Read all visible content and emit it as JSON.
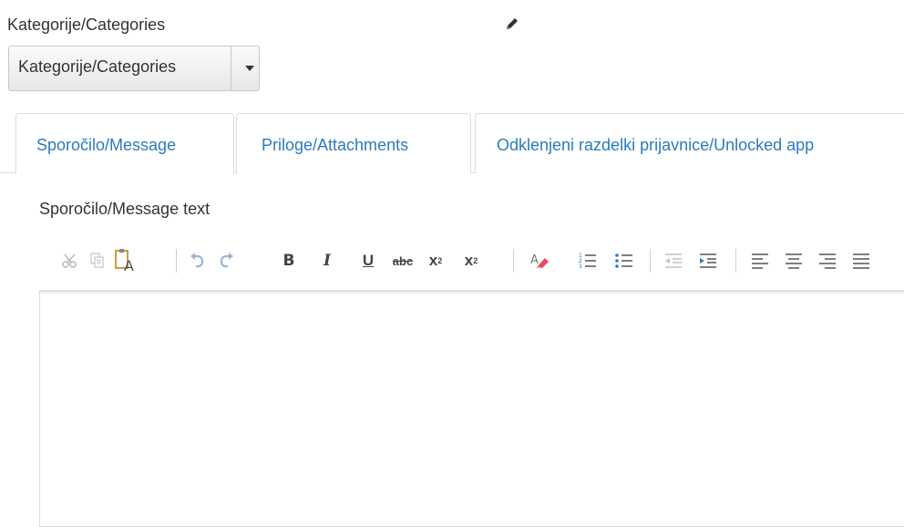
{
  "category": {
    "label": "Kategorije/Categories",
    "select_value": "Kategorije/Categories",
    "edit_icon": "pencil-icon"
  },
  "tabs": [
    {
      "label": "Sporočilo/Message",
      "active": true
    },
    {
      "label": "Priloge/Attachments",
      "active": false
    },
    {
      "label": "Odklenjeni razdelki prijavnice/Unlocked app",
      "active": false
    }
  ],
  "message": {
    "label": "Sporočilo/Message text",
    "content": ""
  },
  "toolbar": {
    "buttons": [
      {
        "name": "cut-icon",
        "enabled": false
      },
      {
        "name": "copy-icon",
        "enabled": false
      },
      {
        "name": "paste-as-text-icon",
        "enabled": true
      },
      {
        "name": "undo-icon",
        "enabled": false
      },
      {
        "name": "redo-icon",
        "enabled": false
      },
      {
        "name": "bold-icon",
        "glyph": "B"
      },
      {
        "name": "italic-icon",
        "glyph": "I"
      },
      {
        "name": "underline-icon",
        "glyph": "U"
      },
      {
        "name": "strikethrough-icon",
        "glyph": "abc"
      },
      {
        "name": "subscript-icon",
        "glyph": "x"
      },
      {
        "name": "superscript-icon",
        "glyph": "x"
      },
      {
        "name": "remove-format-icon"
      },
      {
        "name": "numbered-list-icon"
      },
      {
        "name": "bulleted-list-icon"
      },
      {
        "name": "outdent-icon",
        "enabled": false
      },
      {
        "name": "indent-icon"
      },
      {
        "name": "align-left-icon"
      },
      {
        "name": "align-center-icon"
      },
      {
        "name": "align-right-icon"
      },
      {
        "name": "justify-icon"
      }
    ]
  },
  "colors": {
    "accent": "#2a7bbf",
    "text": "#333333",
    "border": "#dddddd"
  }
}
